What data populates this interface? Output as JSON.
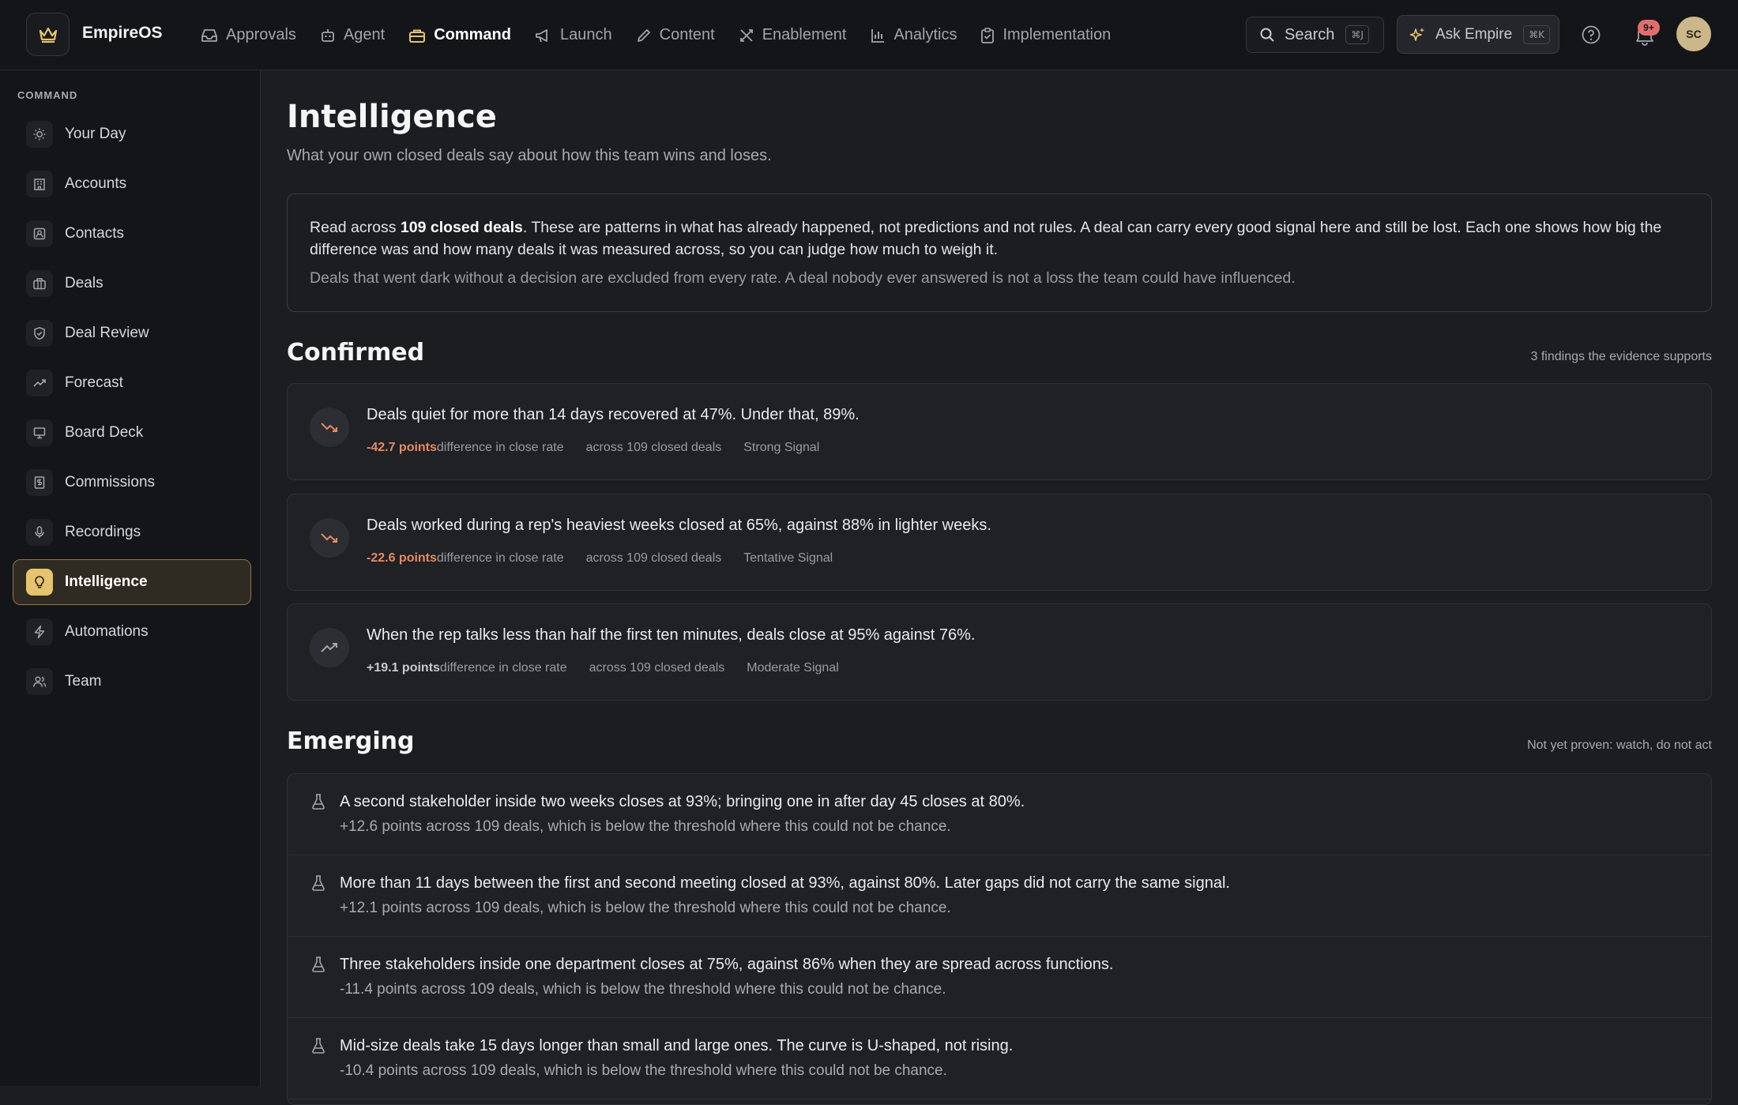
{
  "app": {
    "brand": "EmpireOS"
  },
  "nav": {
    "items": [
      {
        "label": "Approvals",
        "icon": "inbox-icon"
      },
      {
        "label": "Agent",
        "icon": "robot-icon"
      },
      {
        "label": "Command",
        "icon": "briefcase-icon",
        "active": true
      },
      {
        "label": "Launch",
        "icon": "megaphone-icon"
      },
      {
        "label": "Content",
        "icon": "pencil-icon"
      },
      {
        "label": "Enablement",
        "icon": "tools-icon"
      },
      {
        "label": "Analytics",
        "icon": "bar-chart-icon"
      },
      {
        "label": "Implementation",
        "icon": "clipboard-icon"
      }
    ]
  },
  "header": {
    "search_label": "Search",
    "search_kbd": "⌘J",
    "ask_label": "Ask Empire",
    "ask_kbd": "⌘K",
    "notification_badge": "9+",
    "avatar_initials": "SC"
  },
  "sidebar": {
    "heading": "COMMAND",
    "items": [
      {
        "label": "Your Day",
        "icon": "sun-icon"
      },
      {
        "label": "Accounts",
        "icon": "building-icon"
      },
      {
        "label": "Contacts",
        "icon": "contact-card-icon"
      },
      {
        "label": "Deals",
        "icon": "briefcase-icon"
      },
      {
        "label": "Deal Review",
        "icon": "shield-check-icon"
      },
      {
        "label": "Forecast",
        "icon": "trend-up-icon"
      },
      {
        "label": "Board Deck",
        "icon": "presentation-icon"
      },
      {
        "label": "Commissions",
        "icon": "receipt-icon"
      },
      {
        "label": "Recordings",
        "icon": "microphone-icon"
      },
      {
        "label": "Intelligence",
        "icon": "lightbulb-icon",
        "active": true
      },
      {
        "label": "Automations",
        "icon": "lightning-icon"
      },
      {
        "label": "Team",
        "icon": "users-icon"
      }
    ]
  },
  "page": {
    "title": "Intelligence",
    "subtitle": "What your own closed deals say about how this team wins and loses.",
    "intro": {
      "lead_prefix": "Read across ",
      "lead_bold": "109 closed deals",
      "lead_suffix": ". These are patterns in what has already happened, not predictions and not rules. A deal can carry every good signal here and still be lost. Each one shows how big the difference was and how many deals it was measured across, so you can judge how much to weigh it.",
      "note": "Deals that went dark without a decision are excluded from every rate. A deal nobody ever answered is not a loss the team could have influenced."
    }
  },
  "confirmed": {
    "title": "Confirmed",
    "meta": "3 findings the evidence supports",
    "findings": [
      {
        "text": "Deals quiet for more than 14 days recovered at 47%. Under that, 89%.",
        "delta": "-42.7 points",
        "delta_label": " difference in close rate",
        "sample": "across 109 closed deals",
        "strength": "Strong Signal",
        "direction": "down"
      },
      {
        "text": "Deals worked during a rep's heaviest weeks closed at 65%, against 88% in lighter weeks.",
        "delta": "-22.6 points",
        "delta_label": " difference in close rate",
        "sample": "across 109 closed deals",
        "strength": "Tentative Signal",
        "direction": "down"
      },
      {
        "text": "When the rep talks less than half the first ten minutes, deals close at 95% against 76%.",
        "delta": "+19.1 points",
        "delta_label": " difference in close rate",
        "sample": "across 109 closed deals",
        "strength": "Moderate Signal",
        "direction": "up"
      }
    ]
  },
  "emerging": {
    "title": "Emerging",
    "meta": "Not yet proven: watch, do not act",
    "items": [
      {
        "title": "A second stakeholder inside two weeks closes at 93%; bringing one in after day 45 closes at 80%.",
        "sub": "+12.6 points across 109 deals, which is below the threshold where this could not be chance."
      },
      {
        "title": "More than 11 days between the first and second meeting closed at 93%, against 80%. Later gaps did not carry the same signal.",
        "sub": "+12.1 points across 109 deals, which is below the threshold where this could not be chance."
      },
      {
        "title": "Three stakeholders inside one department closes at 75%, against 86% when they are spread across functions.",
        "sub": "-11.4 points across 109 deals, which is below the threshold where this could not be chance."
      },
      {
        "title": "Mid-size deals take 15 days longer than small and large ones. The curve is U-shaped, not rising.",
        "sub": "-10.4 points across 109 deals, which is below the threshold where this could not be chance."
      }
    ]
  },
  "colors": {
    "accent": "#e6c36e",
    "negative": "#e88a63",
    "badge": "#e26d6d"
  }
}
